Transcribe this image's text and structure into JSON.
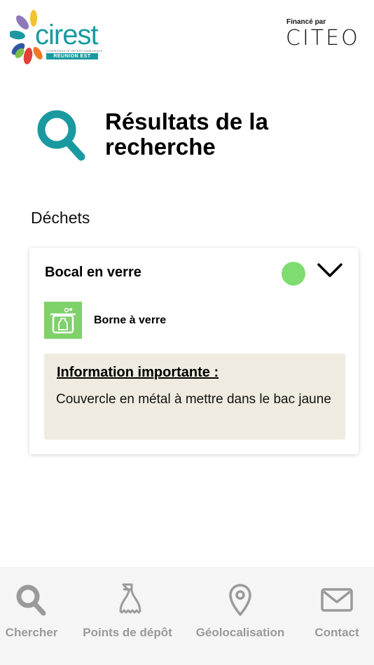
{
  "header": {
    "cirest_logo": {
      "word": "cirest",
      "tagline": "COMMUNAUTÉ INTERCOMMUNALE",
      "region": "RÉUNION EST"
    },
    "citeo_logo": {
      "caption": "Financé par",
      "brand": "CITEO"
    }
  },
  "page": {
    "title": "Résultats de la recherche",
    "section_label": "Déchets"
  },
  "result": {
    "title": "Bocal en verre",
    "status_color": "#7fdc6f",
    "destination": "Borne à verre",
    "destination_color": "#7fd16a",
    "info_title": "Information importante :",
    "info_body": "Couvercle en métal à mettre dans le bac jaune",
    "info_bg": "#efebe0"
  },
  "nav": {
    "items": [
      {
        "label": "Chercher",
        "icon": "search-icon"
      },
      {
        "label": "Points de dépôt",
        "icon": "bottle-icon"
      },
      {
        "label": "Géolocalisation",
        "icon": "location-pin-icon"
      },
      {
        "label": "Contact",
        "icon": "mail-icon"
      }
    ]
  },
  "colors": {
    "accent": "#1a9aa0",
    "nav_text": "#9a9a9a"
  }
}
